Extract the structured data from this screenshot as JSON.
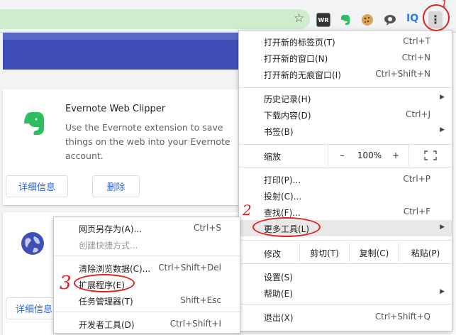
{
  "toolbar": {
    "star_icon": "star-icon",
    "extensions": [
      "WR",
      "evernote-icon",
      "cookie-icon",
      "bubble-icon",
      "IQ"
    ]
  },
  "extension_card": {
    "title": "Evernote Web Clipper",
    "description": "Use the Evernote extension to save things on the web into your Evernote account.",
    "details_button": "详细信息",
    "remove_button": "删除"
  },
  "extension_card2": {
    "details_button": "详细信息"
  },
  "menu": {
    "items_top": [
      {
        "label": "打开新的标签页(T)",
        "shortcut": "Ctrl+T"
      },
      {
        "label": "打开新的窗口(N)",
        "shortcut": "Ctrl+N"
      },
      {
        "label": "打开新的无痕窗口(I)",
        "shortcut": "Ctrl+Shift+N"
      }
    ],
    "history": "历史记录(H)",
    "downloads": {
      "label": "下载内容(D)",
      "shortcut": "Ctrl+J"
    },
    "bookmarks": "书签(B)",
    "zoom": {
      "label": "缩放",
      "minus": "–",
      "value": "100%",
      "plus": "+"
    },
    "print": {
      "label": "打印(P)...",
      "shortcut": "Ctrl+P"
    },
    "cast": "投射(C)...",
    "find": {
      "label": "查找(F)...",
      "shortcut": "Ctrl+F"
    },
    "more_tools": "更多工具(L)",
    "edit": {
      "label": "修改",
      "cut": "剪切(T)",
      "copy": "复制(C)",
      "paste": "粘贴(P)"
    },
    "settings": "设置(S)",
    "help": "帮助(E)",
    "exit": {
      "label": "退出(X)",
      "shortcut": "Ctrl+Shift+Q"
    }
  },
  "submenu": {
    "save_page": {
      "label": "网页另存为(A)...",
      "shortcut": "Ctrl+S"
    },
    "create_shortcut": "创建快捷方式...",
    "clear_data": {
      "label": "清除浏览数据(C)...",
      "shortcut": "Ctrl+Shift+Del"
    },
    "extensions": "扩展程序(E)",
    "task_manager": {
      "label": "任务管理器(T)",
      "shortcut": "Shift+Esc"
    },
    "devtools": {
      "label": "开发者工具(D)",
      "shortcut": "Ctrl+Shift+I"
    }
  },
  "annotations": [
    "1",
    "2",
    "3"
  ],
  "colors": {
    "annotation": "#e02020",
    "banner": "#3f4fb7",
    "link": "#3367d6",
    "omnibox": "#cfeccd"
  }
}
